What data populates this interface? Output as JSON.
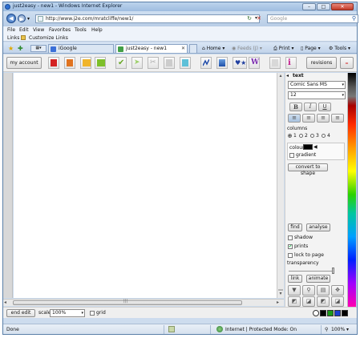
{
  "window": {
    "title": "just2easy - new1 - Windows Internet Explorer",
    "minimize": "–",
    "maximize": "□",
    "close": "✕"
  },
  "address": {
    "url": "http://www.j2e.com/mratcliffe/new1/",
    "search_placeholder": "Google"
  },
  "menu": [
    "File",
    "Edit",
    "View",
    "Favorites",
    "Tools",
    "Help"
  ],
  "links_bar": {
    "label": "Links",
    "item": "Customize Links"
  },
  "tabs": [
    {
      "label": "iGoogle"
    },
    {
      "label": "just2easy - new1"
    }
  ],
  "commands": {
    "home": "Home",
    "feeds": "Feeds (J)",
    "print": "Print",
    "page": "Page",
    "tools": "Tools"
  },
  "toolbar": {
    "account": "my account",
    "revisions": "revisions",
    "minus": "–",
    "italic_w": "W",
    "info": "i"
  },
  "panel": {
    "text_label": "text",
    "font": "Comic Sans MS",
    "size": "12",
    "columns_label": "columns",
    "columns_options": [
      "1",
      "2",
      "3",
      "4"
    ],
    "colour_label": "colour",
    "gradient_label": "gradient",
    "convert_button": "convert to shape",
    "find_button": "find",
    "analyse_button": "analyse",
    "shadow_label": "shadow",
    "prints_label": "prints",
    "lock_label": "lock to page",
    "transparency_label": "transparency",
    "link_button": "link",
    "animate_button": "animate"
  },
  "bottom": {
    "end_edit": "end edit",
    "scale_label": "scale",
    "scale_value": "100%",
    "grid_label": "grid"
  },
  "status": {
    "left": "Done",
    "zone": "Internet | Protected Mode: On",
    "zoom": "100%"
  },
  "colors": {
    "swatches": [
      "#ffffff",
      "#000000",
      "#1a9a1a",
      "#1a3fd0",
      "#000000"
    ]
  }
}
